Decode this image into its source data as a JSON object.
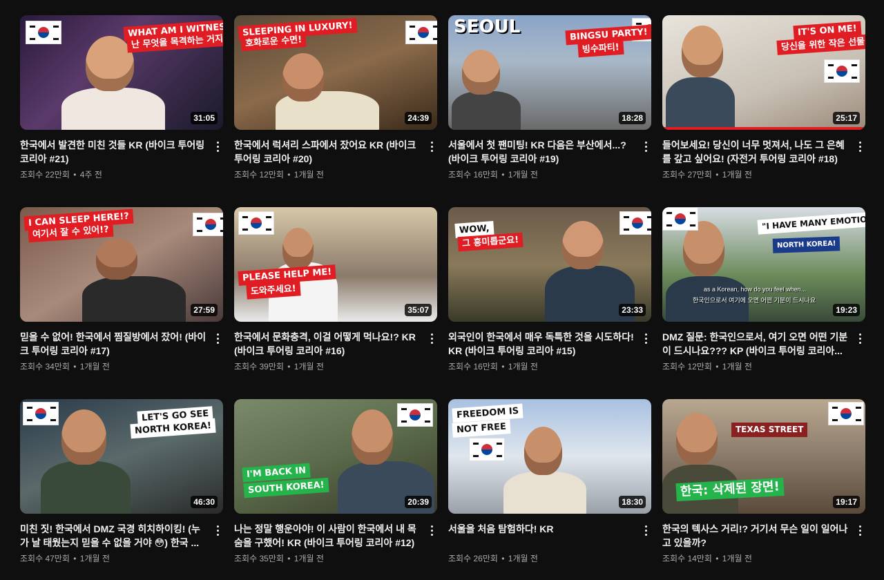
{
  "videos": [
    {
      "title": "한국에서 발견한 미친 것들 KR (바이크 투어링 코리아 #21)",
      "views": "조회수 22만회",
      "age": "4주 전",
      "duration": "31:05",
      "caption": "WHAT AM I WITNESSING!?",
      "caption_sub": "난 무엇을 목격하는 거지!?",
      "progress": 0
    },
    {
      "title": "한국에서 럭셔리 스파에서 잤어요 KR (바이크 투어링 코리아 #20)",
      "views": "조회수 12만회",
      "age": "1개월 전",
      "duration": "24:39",
      "caption": "SLEEPING IN LUXURY!",
      "caption_sub": "호화로운 수면!",
      "progress": 0
    },
    {
      "title": "서울에서 첫 팬미팅! KR 다음은 부산에서...? (바이크 투어링 코리아 #19)",
      "views": "조회수 16만회",
      "age": "1개월 전",
      "duration": "18:28",
      "caption": "BINGSU PARTY!",
      "caption_sub": "빙수파티!",
      "label": "SEOUL",
      "progress": 0
    },
    {
      "title": "들어보세요! 당신이 너무 멋져서, 나도 그 은혜를 갚고 싶어요! (자전거 투어링 코리아 #18)",
      "views": "조회수 27만회",
      "age": "1개월 전",
      "duration": "25:17",
      "caption": "IT'S ON ME!",
      "caption_sub": "당신을 위한 작은 선물!",
      "progress": 100
    },
    {
      "title": "믿을 수 없어! 한국에서 찜질방에서 잤어! (바이크 투어링 코리아 #17)",
      "views": "조회수 34만회",
      "age": "1개월 전",
      "duration": "27:59",
      "caption": "I CAN SLEEP HERE!?",
      "caption_sub": "여기서 잘 수 있어!?",
      "progress": 0
    },
    {
      "title": "한국에서 문화충격, 이걸 어떻게 먹나요!? KR (바이크 투어링 코리아 #16)",
      "views": "조회수 39만회",
      "age": "1개월 전",
      "duration": "35:07",
      "caption": "PLEASE HELP ME!",
      "caption_sub": "도와주세요!",
      "progress": 0
    },
    {
      "title": "외국인이 한국에서 매우 독특한 것을 시도하다! KR (바이크 투어링 코리아 #15)",
      "views": "조회수 16만회",
      "age": "1개월 전",
      "duration": "23:33",
      "caption": "WOW,",
      "caption_sub": "그 흥미롭군요!",
      "progress": 0
    },
    {
      "title": "DMZ 질문: 한국인으로서, 여기 오면 어떤 기분이 드시나요??? KP (바이크 투어링 코리아...",
      "views": "조회수 12만회",
      "age": "1개월 전",
      "duration": "19:23",
      "caption": "\"I HAVE MANY EMOTIONS\"",
      "caption_sub": "NORTH KOREA!",
      "subtitle_en": "as a Korean, how do you feel when...",
      "subtitle_ko": "한국인으로서 여기에 오면 어떤 기분이 드시나요",
      "progress": 0
    },
    {
      "title": "미친 짓! 한국에서 DMZ 국경 히치하이킹! (누가 날 태웠는지 믿을 수 없을 거야 😳) 한국 ...",
      "views": "조회수 47만회",
      "age": "1개월 전",
      "duration": "46:30",
      "caption": "LET'S GO SEE",
      "caption_sub": "NORTH KOREA!",
      "progress": 0
    },
    {
      "title": "나는 정말 행운아야! 이 사람이 한국에서 내 목숨을 구했어! KR (바이크 투어링 코리아 #12)",
      "views": "조회수 35만회",
      "age": "1개월 전",
      "duration": "20:39",
      "caption": "I'M BACK IN",
      "caption_sub": "SOUTH KOREA!",
      "progress": 0
    },
    {
      "title": "서울을 처음 탐험하다! KR",
      "views": "조회수 26만회",
      "age": "1개월 전",
      "duration": "18:30",
      "caption": "FREEDOM IS",
      "caption_sub": "NOT FREE",
      "progress": 0
    },
    {
      "title": "한국의 텍사스 거리!? 거기서 무슨 일이 일어나고 있을까?",
      "views": "조회수 14만회",
      "age": "1개월 전",
      "duration": "19:17",
      "caption": "한국: 삭제된 장면!",
      "caption_sub": "TEXAS STREET",
      "progress": 0
    }
  ],
  "colors": {
    "accent": "#e11d24",
    "bg": "#0f0f0f",
    "meta": "#aaaaaa"
  }
}
